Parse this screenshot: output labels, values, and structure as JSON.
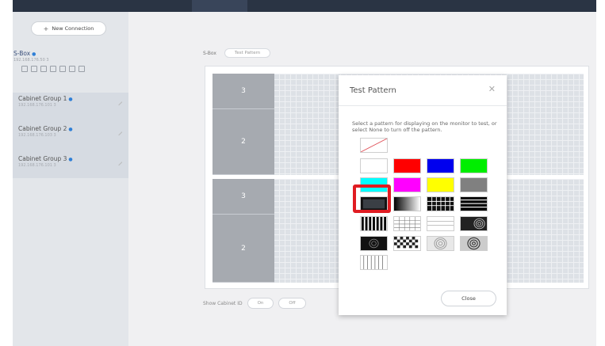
{
  "sidebar": {
    "new_connection_label": "New Connection",
    "device": {
      "name": "S-Box",
      "ip": "192.168.176.50 3"
    },
    "groups": [
      {
        "name": "Cabinet Group 1",
        "ip": "192.168.176.101 3"
      },
      {
        "name": "Cabinet Group 2",
        "ip": "192.168.176.103 3"
      },
      {
        "name": "Cabinet Group 3",
        "ip": "192.168.176.101 3"
      }
    ]
  },
  "breadcrumb": {
    "device": "S-Box",
    "current": "Test Pattern"
  },
  "stage": {
    "cells": [
      "3",
      "2",
      "3",
      "2"
    ]
  },
  "show_cabinet": {
    "label": "Show Cabinet ID",
    "on": "On",
    "off": "Off"
  },
  "dialog": {
    "title": "Test Pattern",
    "description": "Select a pattern for displaying on the monitor to test, or select None to turn off the pattern.",
    "close_label": "Close",
    "selected_pattern": "gray-box",
    "highlight_color": "#e01c22"
  },
  "colors": {
    "topbar": "#2a3444",
    "accent_dot": "#2f7fd6"
  }
}
